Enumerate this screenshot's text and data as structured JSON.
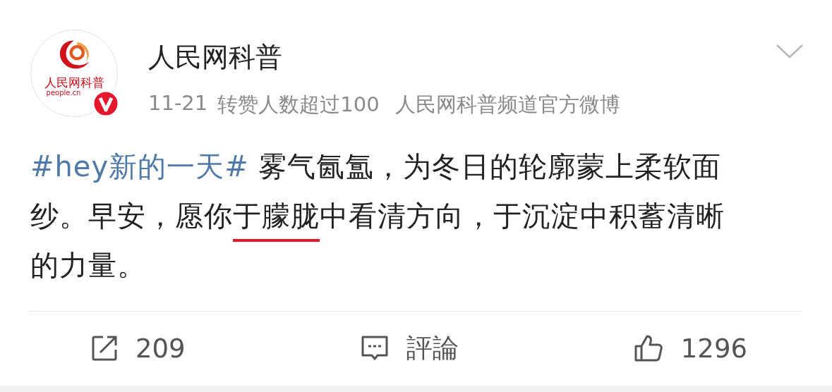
{
  "account": {
    "name": "人民网科普",
    "verified": true,
    "logo_text": "人民网科普",
    "logo_domain": "people.cn"
  },
  "meta": {
    "date": "11-21",
    "highlight": "转赞人数超过100",
    "source": "人民网科普频道官方微博"
  },
  "body": [
    {
      "kind": "hashtag",
      "text": "#hey新的一天#",
      "underlined": false
    },
    {
      "kind": "text",
      "text": " 雾气氤氲，为冬日的轮廓蒙上柔软面纱。早安，愿你",
      "underlined": false
    },
    {
      "kind": "text",
      "text": "于朦胧",
      "underlined": true
    },
    {
      "kind": "text",
      "text": "中看清方向，于沉淀中积蓄清晰的力量。",
      "underlined": false
    }
  ],
  "actions": [
    {
      "kind": "repost",
      "label": "209"
    },
    {
      "kind": "comment",
      "label": "評論"
    },
    {
      "kind": "like",
      "label": "1296"
    }
  ]
}
